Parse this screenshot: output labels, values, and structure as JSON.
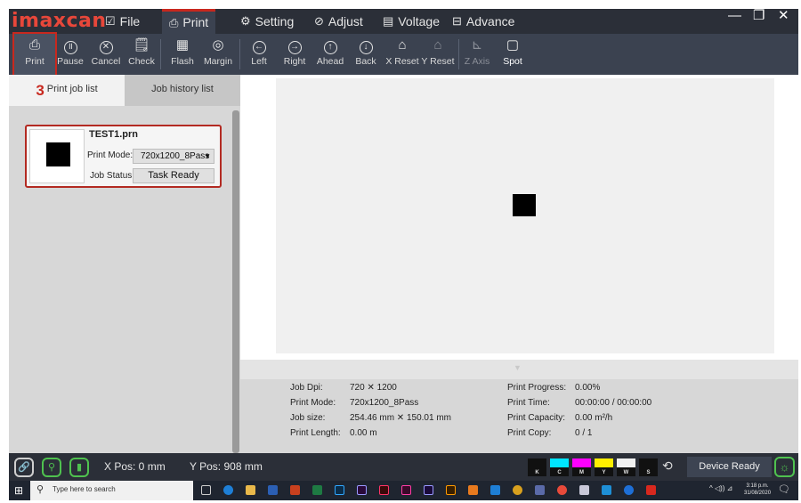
{
  "app": {
    "logo": "imaxcan",
    "menu": [
      {
        "label": "File",
        "icon": "box-check-icon"
      },
      {
        "label": "Print",
        "icon": "printer-icon"
      },
      {
        "label": "Setting",
        "icon": "gear-icon"
      },
      {
        "label": "Adjust",
        "icon": "adjust-icon"
      },
      {
        "label": "Voltage",
        "icon": "voltage-icon"
      },
      {
        "label": "Advance",
        "icon": "advance-icon"
      }
    ],
    "window_controls": {
      "minimize": "—",
      "restore": "❐",
      "close": "✕"
    },
    "accent_color": "#c8281e"
  },
  "toolbar": {
    "print": "Print",
    "pause": "Pause",
    "cancel": "Cancel",
    "check": "Check",
    "flash": "Flash",
    "margin": "Margin",
    "left": "Left",
    "right": "Right",
    "ahead": "Ahead",
    "back": "Back",
    "x_reset": "X Reset",
    "y_reset": "Y Reset",
    "z_axis": "Z Axis",
    "spot": "Spot"
  },
  "left_panel": {
    "step_marker": "3",
    "tab_job_list": "Print job list",
    "tab_job_history": "Job history list",
    "job": {
      "name": "TEST1.prn",
      "print_mode_label": "Print Mode:",
      "print_mode_value": "720x1200_8Pass",
      "status_label": "Job Status:",
      "status_value": "Task Ready"
    }
  },
  "job_info": {
    "job_dpi_label": "Job Dpi:",
    "job_dpi_value": "720 ✕ 1200",
    "print_mode_label": "Print Mode:",
    "print_mode_value": "720x1200_8Pass",
    "job_size_label": "Job size:",
    "job_size_value": "254.46 mm ✕ 150.01 mm",
    "print_length_label": "Print Length:",
    "print_length_value": "0.00 m",
    "print_progress_label": "Print Progress:",
    "print_progress_value": "0.00%",
    "print_time_label": "Print Time:",
    "print_time_value": "00:00:00 / 00:00:00",
    "print_capacity_label": "Print Capacity:",
    "print_capacity_value": "0.00 m²/h",
    "print_copy_label": "Print Copy:",
    "print_copy_value": "0 / 1"
  },
  "status_bar": {
    "x_pos": "X Pos: 0 mm",
    "y_pos": "Y Pos: 908 mm",
    "inks": [
      {
        "letter": "K",
        "color": "#111111"
      },
      {
        "letter": "C",
        "color": "#00e5ff"
      },
      {
        "letter": "M",
        "color": "#ff00ff"
      },
      {
        "letter": "Y",
        "color": "#ffee00"
      },
      {
        "letter": "W",
        "color": "#f0f0f0"
      },
      {
        "letter": "S",
        "color": "#111111"
      }
    ],
    "device_status": "Device Ready"
  },
  "taskbar": {
    "search_placeholder": "Type here to search",
    "time": "3:18 p.m.",
    "date": "31/08/2020"
  }
}
